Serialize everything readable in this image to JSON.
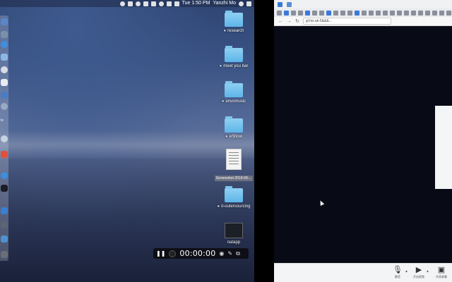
{
  "menubar": {
    "time": "Tue 1:50 PM",
    "user": "Yanzhi Mo"
  },
  "dock": {
    "tv_label": "tv"
  },
  "desktop_icons": [
    {
      "label": "research",
      "kind": "folder"
    },
    {
      "label": "meet you bar",
      "kind": "folder"
    },
    {
      "label": "envomusic",
      "kind": "folder"
    },
    {
      "label": "eShow",
      "kind": "folder"
    },
    {
      "label": "Screenshot 2019-09-...",
      "kind": "document"
    },
    {
      "label": "it-outersourcing",
      "kind": "folder"
    },
    {
      "label": "natapp",
      "kind": "app"
    }
  ],
  "recording": {
    "timer": "00:00:00",
    "pause_glyph": "❚❚",
    "camera_glyph": "◉",
    "pen_glyph": "✎",
    "window_glyph": "⧉"
  },
  "browser": {
    "url_text": "gl.hiz.ak-5&&&...",
    "nav_back": "←",
    "nav_forward": "→",
    "nav_refresh": "↻"
  },
  "meeting_controls": {
    "mute_label": "静音",
    "video_label": "开启视频",
    "share_label": "共享屏幕"
  },
  "colors": {
    "folder_blue": "#5db6e8",
    "browser_dark": "#080a16",
    "accent_blue": "#3b79d9"
  }
}
